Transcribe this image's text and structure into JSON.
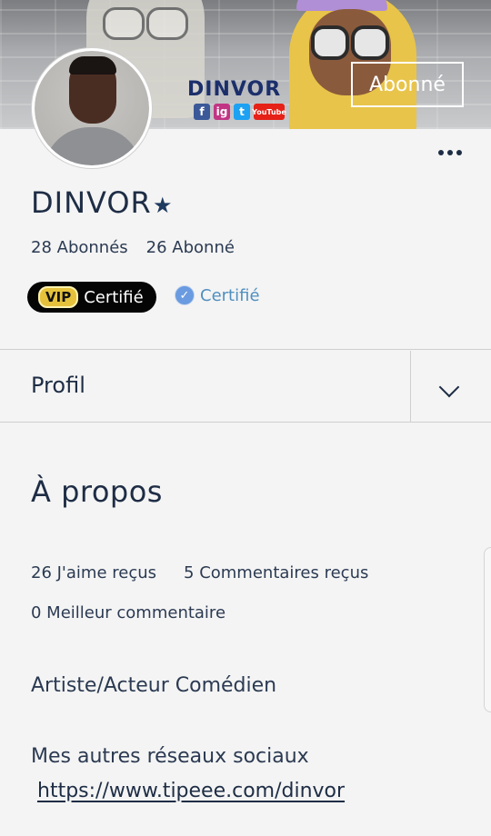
{
  "banner": {
    "brand_text": "DINVOR",
    "socials": [
      "f",
      "ig",
      "t",
      "YouTube"
    ]
  },
  "header": {
    "subscribe_label": "Abonné"
  },
  "profile": {
    "name": "DINVOR",
    "followers_text": "28 Abonnés",
    "following_text": "26 Abonné",
    "vip_pill": "VIP",
    "vip_label": "Certifié",
    "certified_label": "Certifié"
  },
  "tab": {
    "label": "Profil"
  },
  "about": {
    "title": "À propos",
    "likes_received": "26 J'aime reçus",
    "comments_received": "5 Commentaires reçus",
    "best_comment": "0 Meilleur commentaire",
    "role": "Artiste/Acteur Comédien",
    "networks_label": "Mes autres réseaux sociaux",
    "networks_link": "https://www.tipeee.com/dinvor"
  },
  "colors": {
    "text": "#1e2d45",
    "certified": "#4f8fc0",
    "vip_gold": "#e6c23c",
    "vip_bg": "#050505",
    "background": "#f4f4f4"
  }
}
